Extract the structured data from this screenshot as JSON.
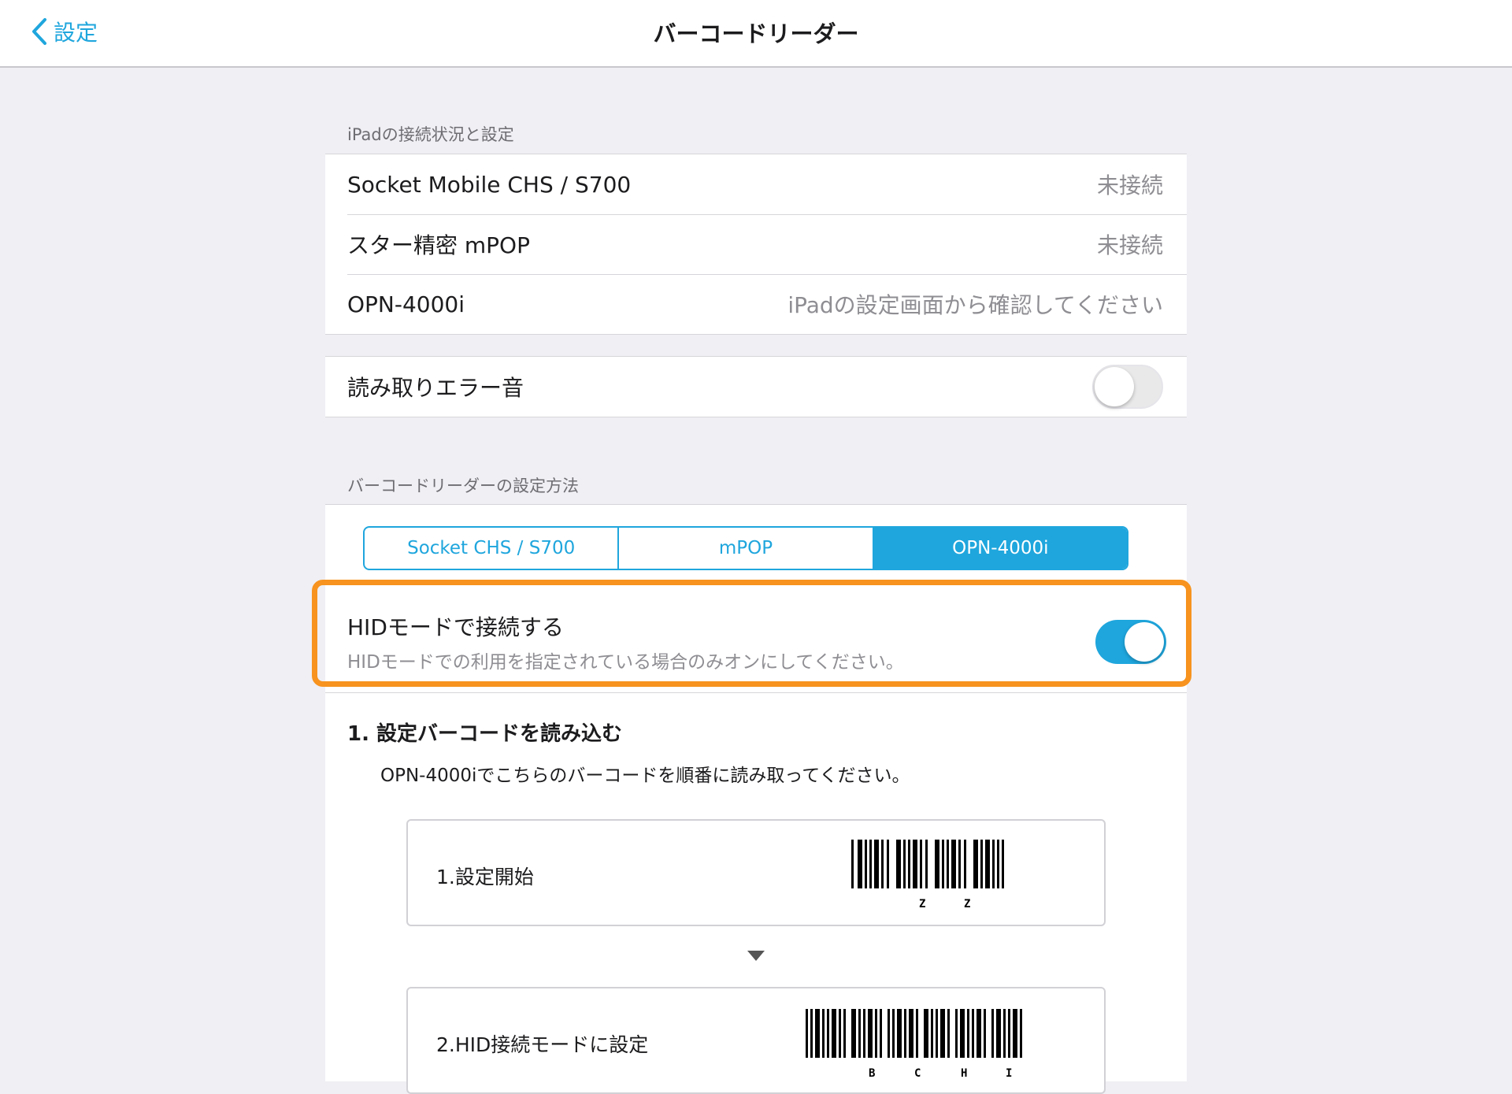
{
  "nav": {
    "back_label": "設定",
    "title": "バーコードリーダー"
  },
  "connection": {
    "header": "iPadの接続状況と設定",
    "rows": [
      {
        "label": "Socket Mobile CHS / S700",
        "value": "未接続"
      },
      {
        "label": "スター精密 mPOP",
        "value": "未接続"
      },
      {
        "label": "OPN-4000i",
        "value": "iPadの設定画面から確認してください"
      }
    ]
  },
  "error_sound": {
    "label": "読み取りエラー音",
    "enabled": false
  },
  "method": {
    "header": "バーコードリーダーの設定方法",
    "segments": [
      "Socket CHS / S700",
      "mPOP",
      "OPN-4000i"
    ],
    "selected_segment": "OPN-4000i",
    "hid": {
      "title": "HIDモードで接続する",
      "subtitle": "HIDモードでの利用を指定されている場合のみオンにしてください。",
      "enabled": true
    },
    "step1": {
      "title": "1. 設定バーコードを読み込む",
      "description": "OPN-4000iでこちらのバーコードを順番に読み取ってください。"
    },
    "barcodes": [
      {
        "label": "1.設定開始",
        "caption": "Z   Z"
      },
      {
        "label": "2.HID接続モードに設定",
        "caption": "B   C   H   I"
      }
    ]
  },
  "colors": {
    "accent": "#1fa6dd",
    "highlight": "#f7931e",
    "background": "#efeff4"
  }
}
